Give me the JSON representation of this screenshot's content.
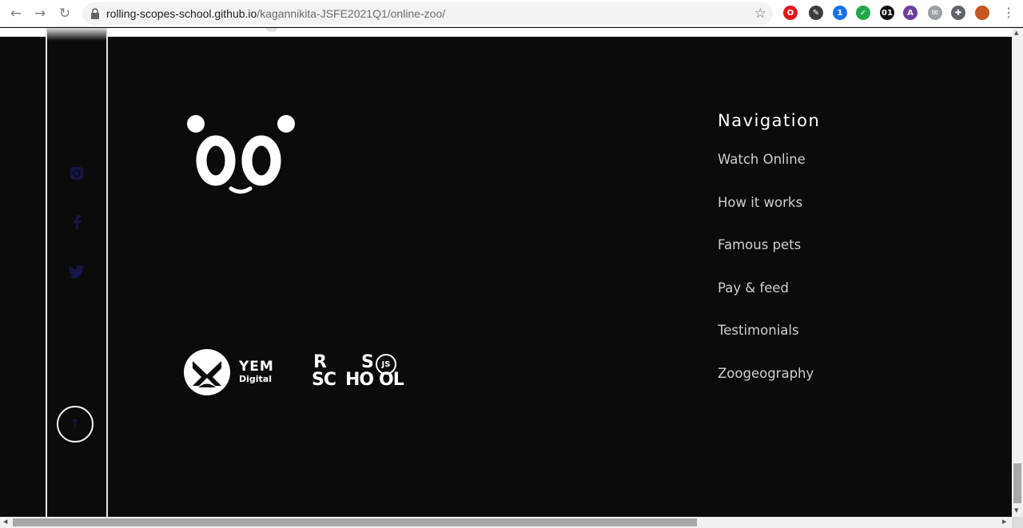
{
  "browser": {
    "url_host": "rolling-scopes-school.github.io",
    "url_path": "/kagannikita-JSFE2021Q1/online-zoo/",
    "back_icon": "←",
    "forward_icon": "→",
    "reload_icon": "↻",
    "star_icon": "☆",
    "menu_icon": "⋮",
    "extensions": [
      {
        "name": "opera-icon",
        "glyph": "O",
        "color": "#e0171f"
      },
      {
        "name": "eyedropper-icon",
        "glyph": "✎",
        "color": "#3d3d3d"
      },
      {
        "name": "lock-extension-icon",
        "glyph": "1",
        "color": "#1a73e8"
      },
      {
        "name": "check-extension-icon",
        "glyph": "✓",
        "color": "#1fa84a"
      },
      {
        "name": "binary-extension-icon",
        "glyph": "01",
        "color": "#111111"
      },
      {
        "name": "chart-extension-icon",
        "glyph": "A",
        "color": "#6b3fa0"
      },
      {
        "name": "tag-extension-icon",
        "glyph": "✉",
        "color": "#9aa0a6"
      },
      {
        "name": "puzzle-icon",
        "glyph": "✚",
        "color": "#5f6368"
      },
      {
        "name": "profile-avatar",
        "glyph": "",
        "color": "#c4571f"
      }
    ]
  },
  "sidebar": {
    "social_icons": [
      "instagram-icon",
      "facebook-icon",
      "twitter-icon"
    ],
    "social_color": "#16164a",
    "up_icon": "↑"
  },
  "partners": {
    "yem_line1": "YEM",
    "yem_line2": "Digital",
    "rs_r": "R",
    "rs_s": "S",
    "rs_js": "JS",
    "rs_line2a": "SC",
    "rs_line2b": "HO",
    "rs_line2c": "OL"
  },
  "footer_nav": {
    "heading": "Navigation",
    "links": [
      "Watch Online",
      "How it works",
      "Famous pets",
      "Pay & feed",
      "Testimonials",
      "Zoogeography"
    ]
  },
  "colors": {
    "background": "#0b0b0b",
    "text": "#ffffff",
    "link": "#d0d0d0"
  }
}
